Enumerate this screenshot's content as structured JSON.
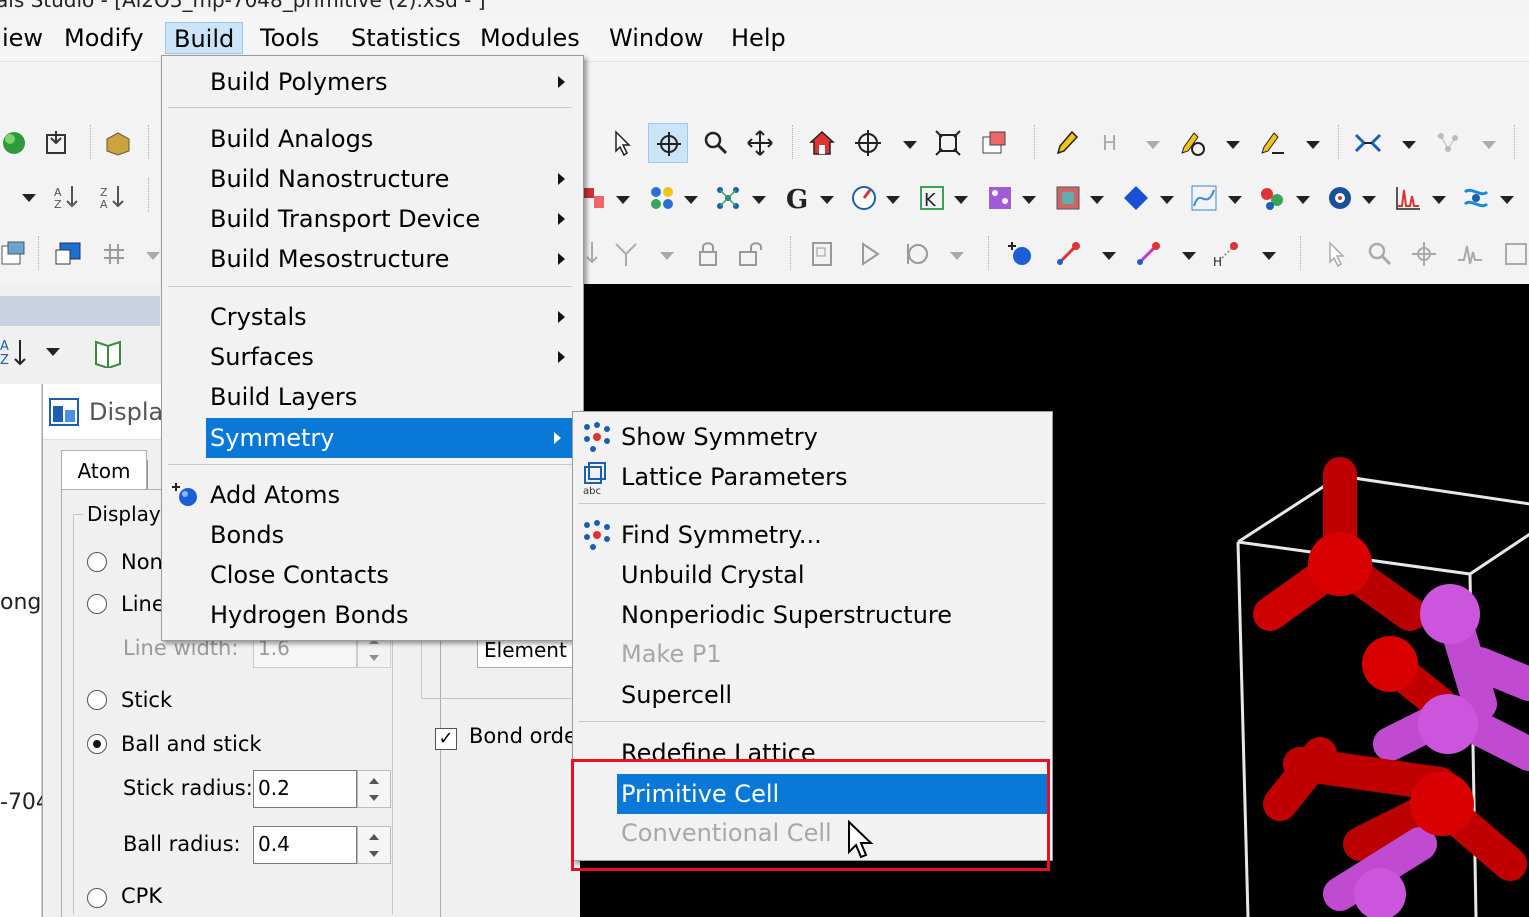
{
  "window": {
    "title_fragment": "als Studio - [Al2O3_mp-7048_primitive (2).xsd - ]"
  },
  "menubar": {
    "items": [
      {
        "label": "iew",
        "active": false
      },
      {
        "label": "Modify",
        "active": false
      },
      {
        "label": "Build",
        "active": true
      },
      {
        "label": "Tools",
        "active": false
      },
      {
        "label": "Statistics",
        "active": false
      },
      {
        "label": "Modules",
        "active": false
      },
      {
        "label": "Window",
        "active": false
      },
      {
        "label": "Help",
        "active": false
      }
    ]
  },
  "build_menu": {
    "items": [
      {
        "label": "Build Polymers",
        "submenu": true
      },
      {
        "label": "Build Analogs",
        "submenu": false
      },
      {
        "label": "Build Nanostructure",
        "submenu": true
      },
      {
        "label": "Build Transport Device",
        "submenu": true
      },
      {
        "label": "Build Mesostructure",
        "submenu": true
      },
      {
        "label": "Crystals",
        "submenu": true
      },
      {
        "label": "Surfaces",
        "submenu": true
      },
      {
        "label": "Build Layers",
        "submenu": false
      },
      {
        "label": "Symmetry",
        "submenu": true,
        "selected": true
      },
      {
        "label": "Add Atoms",
        "submenu": false,
        "icon": "add-atoms-icon"
      },
      {
        "label": "Bonds",
        "submenu": false
      },
      {
        "label": "Close Contacts",
        "submenu": false
      },
      {
        "label": "Hydrogen Bonds",
        "submenu": false
      }
    ]
  },
  "symmetry_menu": {
    "items": [
      {
        "label": "Show Symmetry",
        "icon": "show-symmetry-icon"
      },
      {
        "label": "Lattice Parameters",
        "icon": "lattice-parameters-icon"
      },
      {
        "label": "Find Symmetry...",
        "icon": "find-symmetry-icon"
      },
      {
        "label": "Unbuild Crystal"
      },
      {
        "label": "Nonperiodic Superstructure"
      },
      {
        "label": "Make P1",
        "disabled": true
      },
      {
        "label": "Supercell"
      },
      {
        "label": "Redefine Lattice"
      },
      {
        "label": "Primitive Cell",
        "selected": true
      },
      {
        "label": "Conventional Cell",
        "disabled": true
      }
    ]
  },
  "display_dialog": {
    "title": "Displa",
    "tab_atom": "Atom",
    "group_label": "Display",
    "radio_none": "Non",
    "radio_line": "Line",
    "line_width_label": "Line width:",
    "line_width_value": "1.6",
    "radio_stick": "Stick",
    "radio_ball_stick": "Ball and stick",
    "stick_radius_label": "Stick radius:",
    "stick_radius_value": "0.2",
    "ball_radius_label": "Ball radius:",
    "ball_radius_value": "0.4",
    "radio_cpk": "CPK",
    "element_value": "Element",
    "bond_order_label": "Bond order",
    "selected_style": "Ball and stick"
  },
  "left_side": {
    "text_1": "ong",
    "text_2": "-704"
  },
  "colors": {
    "menu_selected": "#0a78d7",
    "highlight_box": "#e81123",
    "viewer_bg": "#000000",
    "oxygen": "#e00000",
    "aluminum": "#cc55dd"
  }
}
